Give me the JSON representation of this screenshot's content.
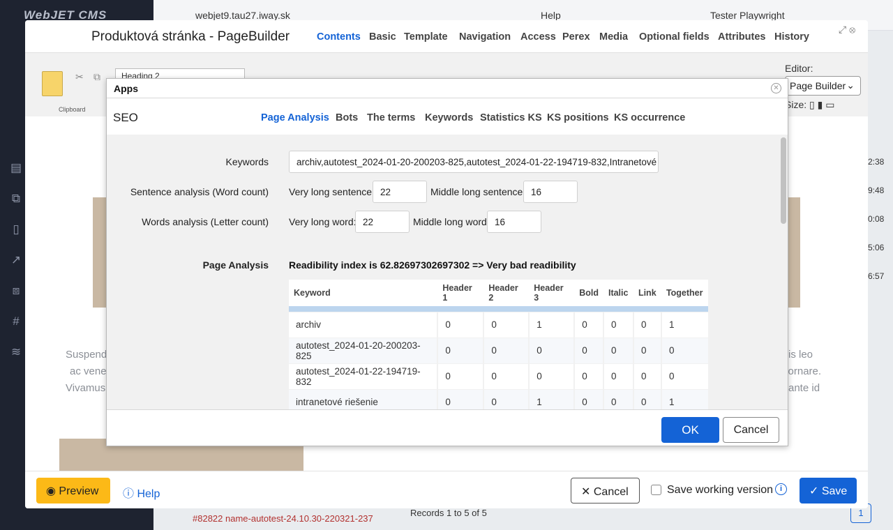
{
  "background": {
    "logo": "WebJET CMS",
    "domain": "webjet9.tau27.iway.sk",
    "help": "Help",
    "user": "Tester Playwright",
    "times": [
      "2:38",
      "9:48",
      "0:08",
      "5:06",
      "6:57"
    ],
    "records": "Records 1 to 5 of 5",
    "footer_link": "#82822 name-autotest-24.10.30-220321-237",
    "page_number": "1"
  },
  "editor": {
    "title": "Produktová stránka - PageBuilder",
    "tabs": [
      "Contents",
      "Basic",
      "Template",
      "Navigation",
      "Access",
      "Perex",
      "Media",
      "Optional fields",
      "Attributes",
      "History"
    ],
    "active_tab": "Contents",
    "ribbon": {
      "clipboard": "Clipboard",
      "heading": "Heading 2",
      "editor_label": "Editor:",
      "editor_value": "Page Builder",
      "size_label": "Size:"
    },
    "ghost_text": {
      "left": [
        "Suspendi",
        "ac vene",
        "Vivamus"
      ],
      "right": [
        "is leo",
        "n ornare.",
        "ante id"
      ]
    },
    "footer": {
      "preview": "Preview",
      "help": "Help",
      "cancel": "Cancel",
      "save_working": "Save working version",
      "save": "Save"
    }
  },
  "apps_dialog": {
    "title": "Apps",
    "seo": {
      "title": "SEO",
      "tabs": [
        "Page Analysis",
        "Bots",
        "The terms",
        "Keywords",
        "Statistics KS",
        "KS positions",
        "KS occurrence"
      ],
      "active_tab": "Page Analysis",
      "keywords_label": "Keywords",
      "keywords_value": "archiv,autotest_2024-01-20-200203-825,autotest_2024-01-22-194719-832,Intranetové riešenie",
      "sentence_label": "Sentence analysis (Word count)",
      "very_long_sentence_label": "Very long sentence:",
      "very_long_sentence": "22",
      "middle_long_sentence_label": "Middle long sentence:",
      "middle_long_sentence": "16",
      "words_label": "Words analysis (Letter count)",
      "very_long_word_label": "Very long word:",
      "very_long_word": "22",
      "middle_long_word_label": "Middle long word:",
      "middle_long_word": "16",
      "page_analysis_label": "Page Analysis",
      "readability": "Readibility index is 62.82697302697302 => Very bad readibility",
      "table": {
        "headers": [
          "Keyword",
          "Header 1",
          "Header 2",
          "Header 3",
          "Bold",
          "Italic",
          "Link",
          "Together"
        ],
        "rows": [
          [
            "archiv",
            "0",
            "0",
            "1",
            "0",
            "0",
            "0",
            "1"
          ],
          [
            "autotest_2024-01-20-200203-825",
            "0",
            "0",
            "0",
            "0",
            "0",
            "0",
            "0"
          ],
          [
            "autotest_2024-01-22-194719-832",
            "0",
            "0",
            "0",
            "0",
            "0",
            "0",
            "0"
          ],
          [
            "intranetové riešenie",
            "0",
            "0",
            "1",
            "0",
            "0",
            "0",
            "1"
          ]
        ]
      }
    },
    "ok": "OK",
    "cancel": "Cancel"
  }
}
